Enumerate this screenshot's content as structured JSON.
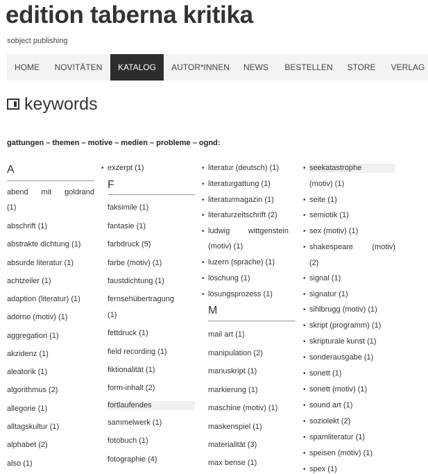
{
  "site": {
    "title": "edition taberna kritika",
    "subtitle": "sobject publishing"
  },
  "nav": [
    "HOME",
    "NOVITÄTEN",
    "KATALOG",
    "AUTOR*INNEN",
    "NEWS",
    "BESTELLEN",
    "STORE",
    "VERLAG"
  ],
  "heading": {
    "icon": "keywords-icon",
    "title": "keywords"
  },
  "categories": "gattungen – themen – motive – medien – probleme – ognd:",
  "col1": {
    "letter": "A",
    "items": [
      "abend mit goldrand",
      "(1)",
      "abschrift (1)",
      "abstrakte dichtung (1)",
      "absurde literatur (1)",
      "achtzeiler (1)",
      "adaption (literatur) (1)",
      "adorno (motiv) (1)",
      "aggregation (1)",
      "akzidenz (1)",
      "aleatorik (1)",
      "algorithmus (2)",
      "allegorie (1)",
      "alltagskultur (1)",
      "alphabet (2)",
      "also (1)"
    ]
  },
  "col2": {
    "top": "exzerpt (1)",
    "letter": "F",
    "items": [
      "faksimile (1)",
      "fantasie (1)",
      "farbdruck (5)",
      "farbe (motiv) (1)",
      "faustdichtung (1)",
      "fernsehübertragung",
      "(1)",
      "fettdruck (1)",
      "field recording (1)",
      "fiktionalität (1)",
      "form-inhalt (2)",
      "fortlaufendes",
      "sammelwerk (1)",
      "fotobuch (1)",
      "fotographie (4)"
    ]
  },
  "col3": {
    "items": [
      "literatur (deutsch) (1)",
      "literaturgattung (1)",
      "literaturmagazin (1)",
      "literaturzeitschrift (2)",
      "ludwig wittgenstein",
      "(motiv) (1)",
      "luzern (sprache) (1)",
      "löschung (1)",
      "lösungsprozess (1)"
    ],
    "letter": "M",
    "items2": [
      "mail art (1)",
      "manipulation (2)",
      "manuskript (1)",
      "markierung (1)",
      "maschine (motiv) (1)",
      "maskenspiel (1)",
      "materialität (3)",
      "max bense (1)"
    ]
  },
  "col4": {
    "items": [
      "seekatastrophe",
      "(motiv) (1)",
      "seite (1)",
      "semiotik (1)",
      "sex (motiv) (1)",
      "shakespeare (motiv)",
      "(2)",
      "signal (1)",
      "signatur (1)",
      "sihlbrugg (motiv) (1)",
      "skript (programm) (1)",
      "skripturale kunst (1)",
      "sonderausgabe (1)",
      "sonett (1)",
      "sonett (motiv) (1)",
      "sound art (1)",
      "soziolekt (2)",
      "spamliteratur (1)",
      "speisen (motiv) (1)",
      "spex (1)"
    ]
  }
}
